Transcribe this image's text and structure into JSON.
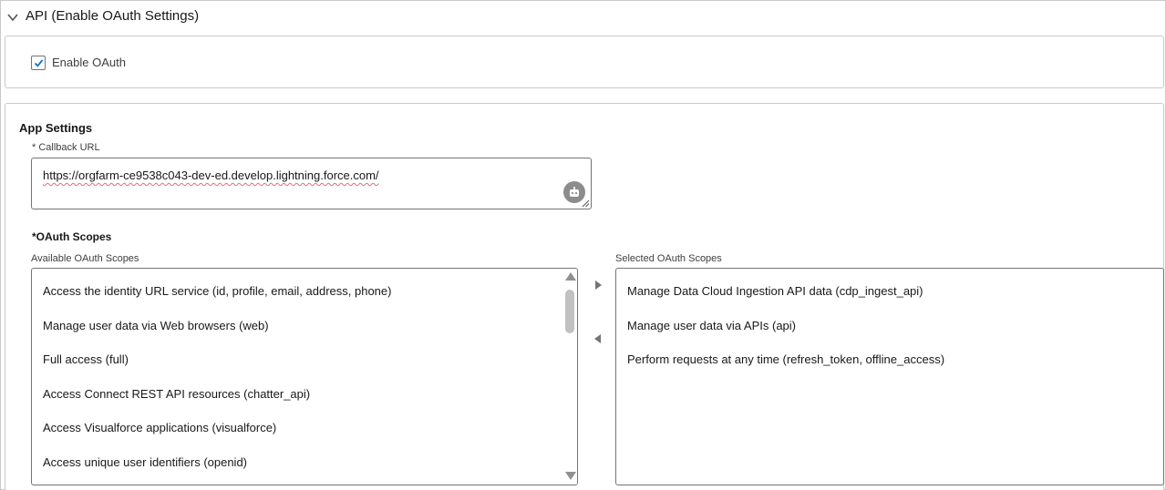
{
  "section": {
    "title": "API (Enable OAuth Settings)",
    "chevron_icon": "chevron-down-icon"
  },
  "oauth": {
    "checkbox_label": "Enable OAuth",
    "checked": true
  },
  "app_settings": {
    "title": "App Settings",
    "callback": {
      "required_mark": "*",
      "label": "Callback URL",
      "value": "https://orgfarm-ce9538c043-dev-ed.develop.lightning.force.com/",
      "helper_icon": "bot-icon"
    },
    "scopes": {
      "required_mark": "*",
      "title": "OAuth Scopes",
      "available_label": "Available OAuth Scopes",
      "selected_label": "Selected OAuth Scopes",
      "available": [
        "Access the identity URL service (id, profile, email, address, phone)",
        "Manage user data via Web browsers (web)",
        "Full access (full)",
        "Access Connect REST API resources (chatter_api)",
        "Access Visualforce applications (visualforce)",
        "Access unique user identifiers (openid)"
      ],
      "selected": [
        "Manage Data Cloud Ingestion API data (cdp_ingest_api)",
        "Manage user data via APIs (api)",
        "Perform requests at any time (refresh_token, offline_access)"
      ]
    }
  },
  "colors": {
    "border": "#c9c9c9",
    "field_border": "#747474",
    "checkbox_accent": "#0176d3",
    "spellcheck_underline": "#e07070"
  }
}
